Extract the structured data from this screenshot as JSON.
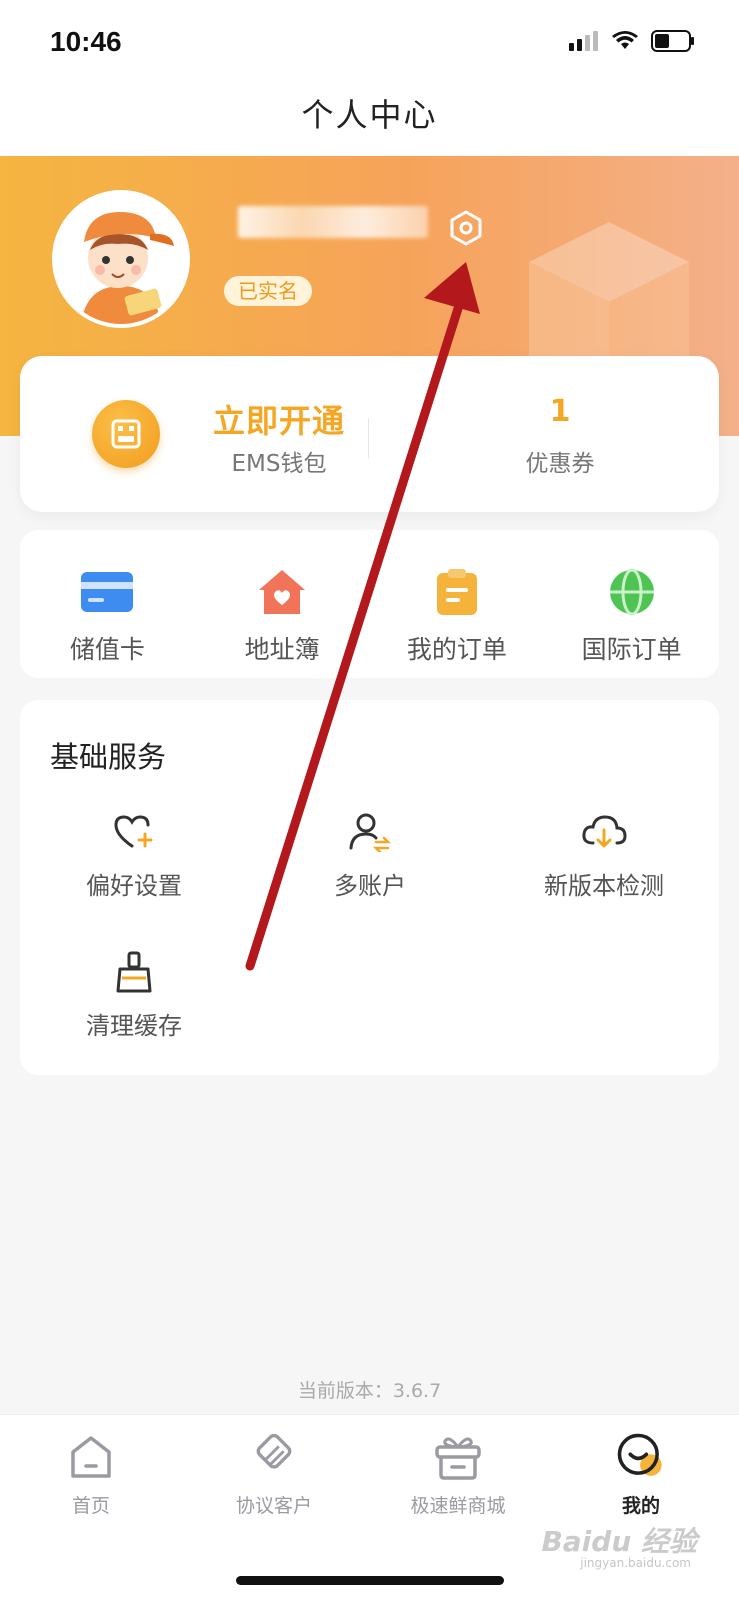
{
  "status_bar": {
    "time": "10:46"
  },
  "nav": {
    "title": "个人中心"
  },
  "profile": {
    "verified_label": "已实名",
    "avatar": "courier-avatar",
    "settings_icon": "settings-hex-icon"
  },
  "wallet": {
    "open_label": "立即开通",
    "wallet_label": "EMS钱包",
    "coupon_count": "1",
    "coupon_label": "优惠券"
  },
  "shortcuts": [
    {
      "label": "储值卡",
      "icon": "card-icon"
    },
    {
      "label": "地址簿",
      "icon": "house-heart-icon"
    },
    {
      "label": "我的订单",
      "icon": "clipboard-icon"
    },
    {
      "label": "国际订单",
      "icon": "globe-icon"
    }
  ],
  "services": {
    "title": "基础服务",
    "items": [
      {
        "label": "偏好设置",
        "icon": "heart-plus-icon"
      },
      {
        "label": "多账户",
        "icon": "user-switch-icon"
      },
      {
        "label": "新版本检测",
        "icon": "cloud-download-icon"
      },
      {
        "label": "清理缓存",
        "icon": "brush-icon"
      }
    ]
  },
  "version": "当前版本：3.6.7",
  "tabs": [
    {
      "label": "首页",
      "icon": "home-icon"
    },
    {
      "label": "协议客户",
      "icon": "handshake-icon"
    },
    {
      "label": "极速鲜商城",
      "icon": "gift-box-icon"
    },
    {
      "label": "我的",
      "icon": "smile-icon"
    }
  ],
  "watermark": {
    "text": "Baidu 经验",
    "url": "jingyan.baidu.com"
  },
  "colors": {
    "accent": "#f5a623",
    "header_start": "#f5b540",
    "header_end": "#f4b08a",
    "annotation": "#b3191c"
  }
}
